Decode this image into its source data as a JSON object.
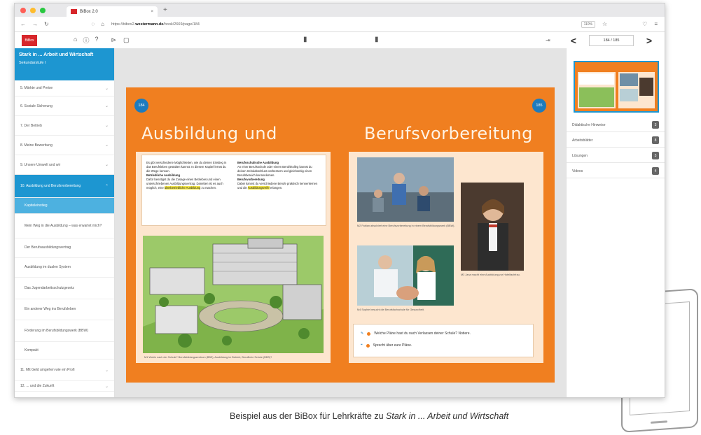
{
  "browser": {
    "tab_title": "BiBox 2.0",
    "tab_close": "×",
    "new_tab": "+",
    "url_prefix": "https://bibox2.",
    "url_domain": "westermann.de",
    "url_path": "/book/2669/page/184",
    "zoom": "110%",
    "traffic_colors": [
      "#ff5f57",
      "#febc2e",
      "#28c840"
    ]
  },
  "app": {
    "logo_text": "BiBox",
    "page_indicator": "184 / 185",
    "prev_arrow": "<",
    "next_arrow": ">"
  },
  "sidebar": {
    "book_title": "Stark in ... Arbeit und Wirtschaft",
    "book_subtitle": "Sekundarstufe I",
    "items_before": [
      "5. Märkte und Preise",
      "6. Soziale Sicherung",
      "7. Der Betrieb",
      "8. Meine Bewerbung",
      "9. Unsere Umwelt und wir"
    ],
    "active_chapter": "10. Ausbildung und Berufsvorbereitung",
    "subitems": [
      "Kapiteleinstieg",
      "Mein Weg in die Ausbildung – was erwartet mich?",
      "Der Berufsausbildungsvertrag",
      "Ausbildung im dualen System",
      "Das Jugendarbeitsschutzgesetz",
      "Ein anderer Weg ins Berufsleben",
      "Förderung im Berufsbildungswerk (BBW)",
      "Kompakt"
    ],
    "items_after": [
      "11. Mit Geld umgehen wie ein Profi",
      "12. ... und die Zukunft"
    ]
  },
  "spread": {
    "left_page_number": "184",
    "right_page_number": "185",
    "heading_left": "Ausbildung und",
    "heading_right": "Berufsvorbereitung",
    "text_col1_a": "Es gibt verschiedene Möglichkeiten, wie du deinen Einstieg in das Berufsleben gestalten kannst. In diesem Kapitel lernst du die Wege kennen.",
    "text_col1_b_title": "Betriebliche Ausbildung",
    "text_col1_b": "Dafür benötigst du die Zusage eines Betriebes und einen unterschriebenen Ausbildungsvertrag. Daneben ist es auch möglich, eine",
    "text_col1_hl": "überbetriebliche Ausbildung",
    "text_col1_end": "zu machen.",
    "text_col2_title": "Berufsschulische Ausbildung",
    "text_col2_a": "An einer Berufsschule oder einem Berufskolleg kannst du deinen Schulabschluss verbessern und gleichzeitig einen Berufsbereich kennenlernen.",
    "text_col2_b_title": "Berufsvorbereitung",
    "text_col2_b": "Dabei kannst du verschiedene Berufe praktisch kennenlernen und die",
    "text_col2_hl": "Ausbildungsreife",
    "text_col2_end": "erlangen.",
    "caption_illustration": "M1   Wohin nach der Schule? Berufsbildungszentrum (BBZ), Ausbildung im Betrieb, Berufliche Schule (BBS)?",
    "caption_photo1": "M2   Fabian absolviert eine Berufsvorbereitung in einem Berufsbildungswerk (BBW).",
    "caption_photo2": "M3   Jana macht eine Ausbildung zur Hotelfachfrau.",
    "caption_photo3": "M4   Sophie besucht die Berufsfachschule für Gesundheit.",
    "task1": "Welche Pläne hast du nach Verlassen deiner Schule? Notiere.",
    "task2": "Sprecht über eure Pläne.",
    "orange": "#f07f20",
    "accent_blue": "#1d7bbd"
  },
  "right_panel": {
    "resources": [
      {
        "label": "Didaktische Hinweise",
        "count": "3"
      },
      {
        "label": "Arbeitsblätter",
        "count": "8"
      },
      {
        "label": "Lösungen",
        "count": "3"
      },
      {
        "label": "Videos",
        "count": "4"
      }
    ]
  },
  "caption": {
    "prefix": "Beispiel aus der BiBox für Lehrkräfte zu ",
    "italic": "Stark in ... Arbeit und Wirtschaft"
  }
}
